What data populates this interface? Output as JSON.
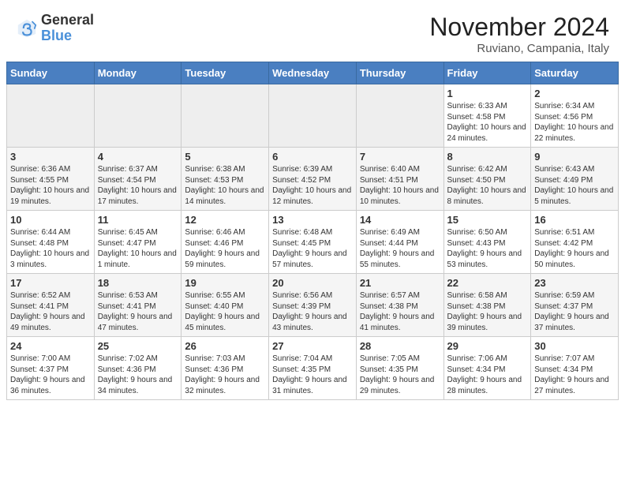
{
  "header": {
    "logo_general": "General",
    "logo_blue": "Blue",
    "month_title": "November 2024",
    "location": "Ruviano, Campania, Italy"
  },
  "days_of_week": [
    "Sunday",
    "Monday",
    "Tuesday",
    "Wednesday",
    "Thursday",
    "Friday",
    "Saturday"
  ],
  "weeks": [
    [
      {
        "day": "",
        "info": ""
      },
      {
        "day": "",
        "info": ""
      },
      {
        "day": "",
        "info": ""
      },
      {
        "day": "",
        "info": ""
      },
      {
        "day": "",
        "info": ""
      },
      {
        "day": "1",
        "info": "Sunrise: 6:33 AM\nSunset: 4:58 PM\nDaylight: 10 hours and 24 minutes."
      },
      {
        "day": "2",
        "info": "Sunrise: 6:34 AM\nSunset: 4:56 PM\nDaylight: 10 hours and 22 minutes."
      }
    ],
    [
      {
        "day": "3",
        "info": "Sunrise: 6:36 AM\nSunset: 4:55 PM\nDaylight: 10 hours and 19 minutes."
      },
      {
        "day": "4",
        "info": "Sunrise: 6:37 AM\nSunset: 4:54 PM\nDaylight: 10 hours and 17 minutes."
      },
      {
        "day": "5",
        "info": "Sunrise: 6:38 AM\nSunset: 4:53 PM\nDaylight: 10 hours and 14 minutes."
      },
      {
        "day": "6",
        "info": "Sunrise: 6:39 AM\nSunset: 4:52 PM\nDaylight: 10 hours and 12 minutes."
      },
      {
        "day": "7",
        "info": "Sunrise: 6:40 AM\nSunset: 4:51 PM\nDaylight: 10 hours and 10 minutes."
      },
      {
        "day": "8",
        "info": "Sunrise: 6:42 AM\nSunset: 4:50 PM\nDaylight: 10 hours and 8 minutes."
      },
      {
        "day": "9",
        "info": "Sunrise: 6:43 AM\nSunset: 4:49 PM\nDaylight: 10 hours and 5 minutes."
      }
    ],
    [
      {
        "day": "10",
        "info": "Sunrise: 6:44 AM\nSunset: 4:48 PM\nDaylight: 10 hours and 3 minutes."
      },
      {
        "day": "11",
        "info": "Sunrise: 6:45 AM\nSunset: 4:47 PM\nDaylight: 10 hours and 1 minute."
      },
      {
        "day": "12",
        "info": "Sunrise: 6:46 AM\nSunset: 4:46 PM\nDaylight: 9 hours and 59 minutes."
      },
      {
        "day": "13",
        "info": "Sunrise: 6:48 AM\nSunset: 4:45 PM\nDaylight: 9 hours and 57 minutes."
      },
      {
        "day": "14",
        "info": "Sunrise: 6:49 AM\nSunset: 4:44 PM\nDaylight: 9 hours and 55 minutes."
      },
      {
        "day": "15",
        "info": "Sunrise: 6:50 AM\nSunset: 4:43 PM\nDaylight: 9 hours and 53 minutes."
      },
      {
        "day": "16",
        "info": "Sunrise: 6:51 AM\nSunset: 4:42 PM\nDaylight: 9 hours and 50 minutes."
      }
    ],
    [
      {
        "day": "17",
        "info": "Sunrise: 6:52 AM\nSunset: 4:41 PM\nDaylight: 9 hours and 49 minutes."
      },
      {
        "day": "18",
        "info": "Sunrise: 6:53 AM\nSunset: 4:41 PM\nDaylight: 9 hours and 47 minutes."
      },
      {
        "day": "19",
        "info": "Sunrise: 6:55 AM\nSunset: 4:40 PM\nDaylight: 9 hours and 45 minutes."
      },
      {
        "day": "20",
        "info": "Sunrise: 6:56 AM\nSunset: 4:39 PM\nDaylight: 9 hours and 43 minutes."
      },
      {
        "day": "21",
        "info": "Sunrise: 6:57 AM\nSunset: 4:38 PM\nDaylight: 9 hours and 41 minutes."
      },
      {
        "day": "22",
        "info": "Sunrise: 6:58 AM\nSunset: 4:38 PM\nDaylight: 9 hours and 39 minutes."
      },
      {
        "day": "23",
        "info": "Sunrise: 6:59 AM\nSunset: 4:37 PM\nDaylight: 9 hours and 37 minutes."
      }
    ],
    [
      {
        "day": "24",
        "info": "Sunrise: 7:00 AM\nSunset: 4:37 PM\nDaylight: 9 hours and 36 minutes."
      },
      {
        "day": "25",
        "info": "Sunrise: 7:02 AM\nSunset: 4:36 PM\nDaylight: 9 hours and 34 minutes."
      },
      {
        "day": "26",
        "info": "Sunrise: 7:03 AM\nSunset: 4:36 PM\nDaylight: 9 hours and 32 minutes."
      },
      {
        "day": "27",
        "info": "Sunrise: 7:04 AM\nSunset: 4:35 PM\nDaylight: 9 hours and 31 minutes."
      },
      {
        "day": "28",
        "info": "Sunrise: 7:05 AM\nSunset: 4:35 PM\nDaylight: 9 hours and 29 minutes."
      },
      {
        "day": "29",
        "info": "Sunrise: 7:06 AM\nSunset: 4:34 PM\nDaylight: 9 hours and 28 minutes."
      },
      {
        "day": "30",
        "info": "Sunrise: 7:07 AM\nSunset: 4:34 PM\nDaylight: 9 hours and 27 minutes."
      }
    ]
  ]
}
